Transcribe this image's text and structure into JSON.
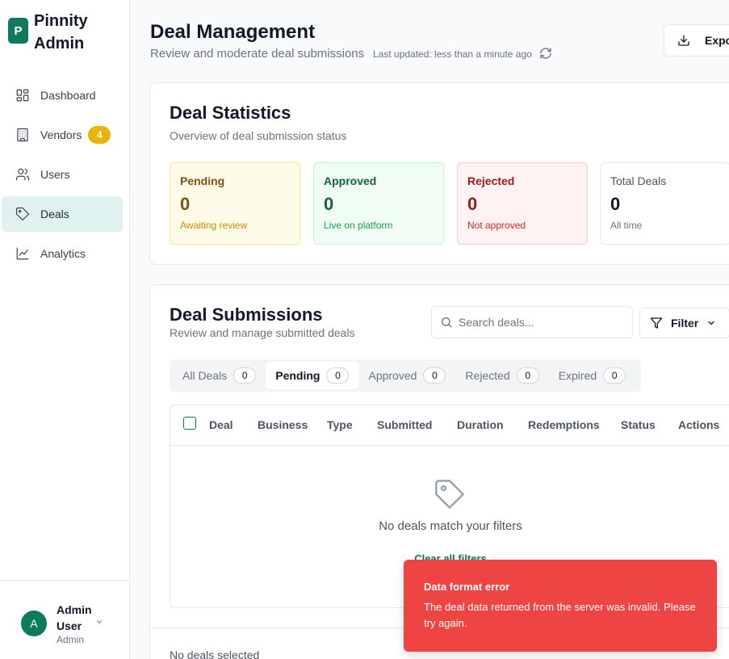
{
  "brand": {
    "logo_letter": "P",
    "name": "Pinnity Admin"
  },
  "sidebar": {
    "items": [
      {
        "label": "Dashboard",
        "icon": "grid-icon"
      },
      {
        "label": "Vendors",
        "icon": "building-icon",
        "badge": "4"
      },
      {
        "label": "Users",
        "icon": "users-icon"
      },
      {
        "label": "Deals",
        "icon": "tag-icon",
        "active": true
      },
      {
        "label": "Analytics",
        "icon": "chart-line-icon"
      }
    ]
  },
  "user": {
    "initial": "A",
    "name": "Admin User",
    "role": "Admin"
  },
  "header": {
    "title": "Deal Management",
    "subtitle": "Review and moderate deal submissions",
    "last_updated": "Last updated: less than a minute ago",
    "export_label": "Export"
  },
  "stats": {
    "title": "Deal Statistics",
    "subtitle": "Overview of deal submission status",
    "pending": {
      "label": "Pending",
      "value": "0",
      "desc": "Awaiting review"
    },
    "approved": {
      "label": "Approved",
      "value": "0",
      "desc": "Live on platform"
    },
    "rejected": {
      "label": "Rejected",
      "value": "0",
      "desc": "Not approved"
    },
    "total": {
      "label": "Total Deals",
      "value": "0",
      "desc": "All time"
    }
  },
  "submissions": {
    "title": "Deal Submissions",
    "subtitle": "Review and manage submitted deals",
    "search_placeholder": "Search deals...",
    "filter_label": "Filter",
    "tabs": [
      {
        "label": "All Deals",
        "count": "0"
      },
      {
        "label": "Pending",
        "count": "0",
        "active": true
      },
      {
        "label": "Approved",
        "count": "0"
      },
      {
        "label": "Rejected",
        "count": "0"
      },
      {
        "label": "Expired",
        "count": "0"
      }
    ],
    "columns": [
      "Deal",
      "Business",
      "Type",
      "Submitted",
      "Duration",
      "Redemptions",
      "Status",
      "Actions"
    ],
    "empty_text": "No deals match your filters",
    "clear_filters": "Clear all filters",
    "selection_text": "No deals selected"
  },
  "toast": {
    "title": "Data format error",
    "message": "The deal data returned from the server was invalid. Please try again.",
    "color": "#ef4444"
  },
  "colors": {
    "accent": "#0e7a5e",
    "badge": "#eab308"
  }
}
